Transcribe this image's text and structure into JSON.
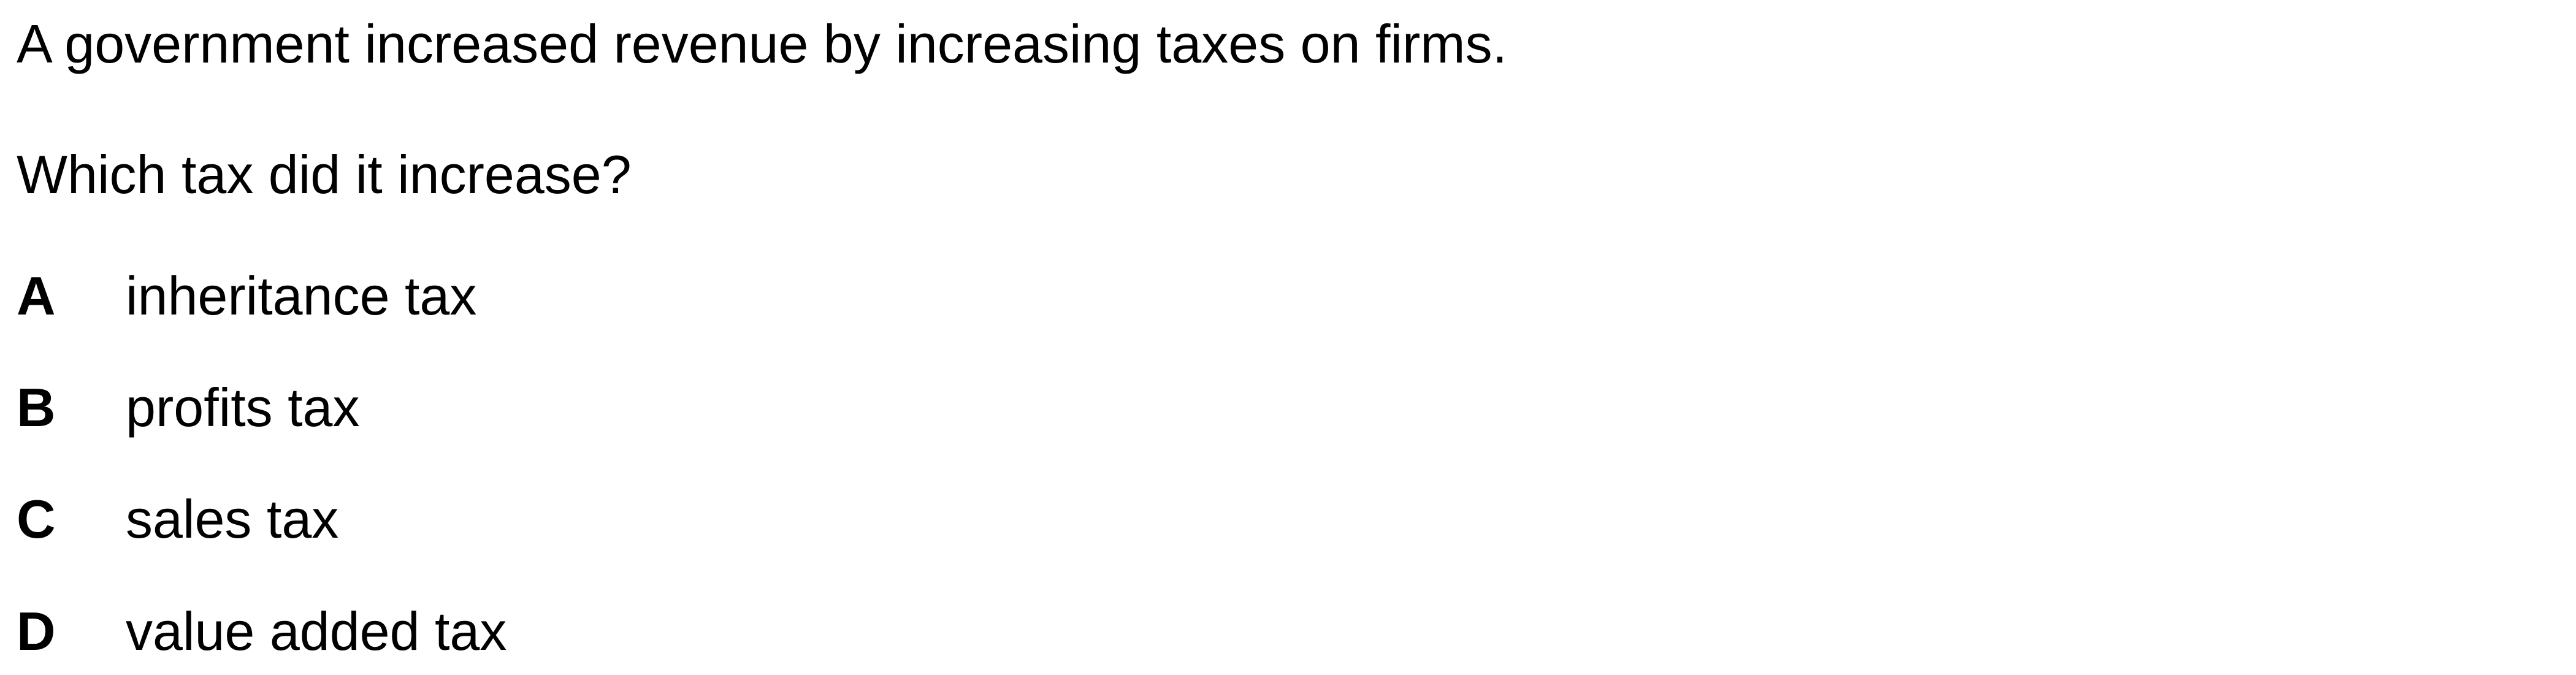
{
  "question": {
    "stem": "A government increased revenue by increasing taxes on firms.",
    "prompt": "Which tax did it increase?",
    "options": [
      {
        "letter": "A",
        "text": "inheritance tax"
      },
      {
        "letter": "B",
        "text": "profits tax"
      },
      {
        "letter": "C",
        "text": "sales tax"
      },
      {
        "letter": "D",
        "text": "value added tax"
      }
    ]
  }
}
